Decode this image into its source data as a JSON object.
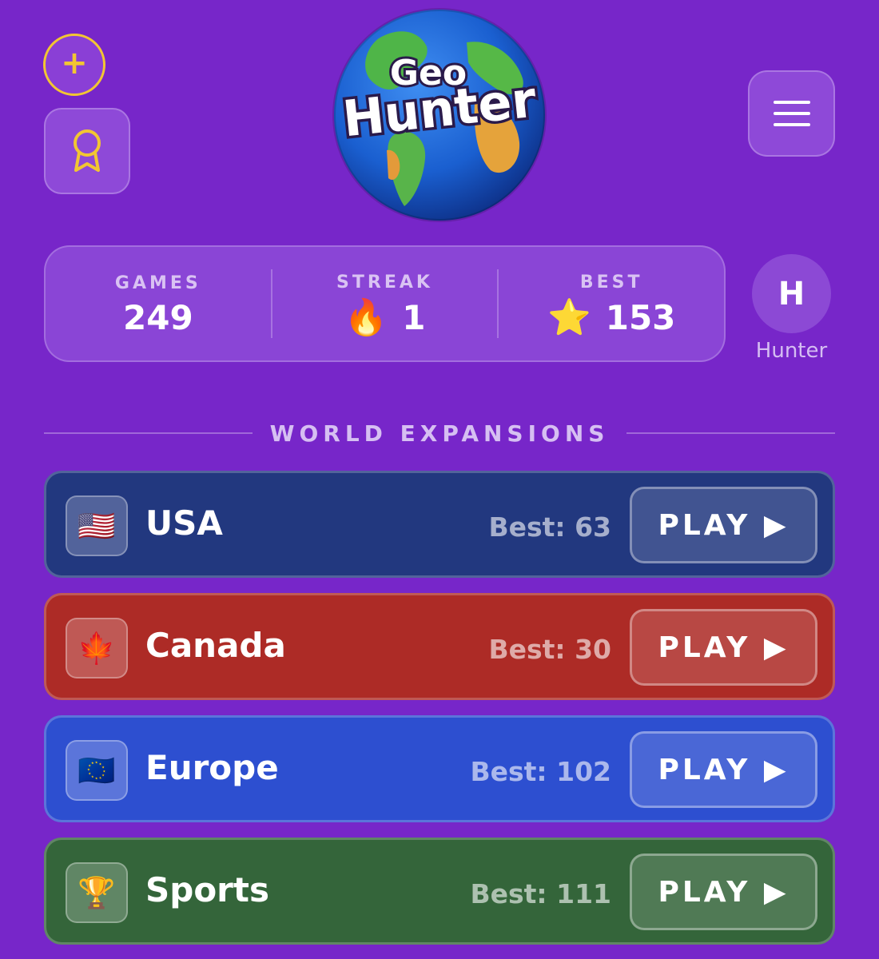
{
  "app": {
    "logo_line1": "Geo",
    "logo_line2": "Hunter"
  },
  "icons": {
    "add": "plus-icon",
    "achievements": "ribbon-award-icon",
    "menu": "hamburger-menu-icon"
  },
  "stats": {
    "games": {
      "label": "GAMES",
      "value": "249"
    },
    "streak": {
      "label": "STREAK",
      "icon": "🔥",
      "value": "1"
    },
    "best": {
      "label": "BEST",
      "icon": "⭐",
      "value": "153"
    }
  },
  "profile": {
    "initial": "H",
    "name": "Hunter"
  },
  "section": {
    "title": "WORLD EXPANSIONS"
  },
  "expansions": [
    {
      "name": "USA",
      "flag": "🇺🇸",
      "best": "Best: 63",
      "play": "PLAY ▶",
      "color": "#22387f"
    },
    {
      "name": "Canada",
      "flag": "🍁",
      "best": "Best: 30",
      "play": "PLAY ▶",
      "color": "#ad2b26"
    },
    {
      "name": "Europe",
      "flag": "🇪🇺",
      "best": "Best: 102",
      "play": "PLAY ▶",
      "color": "#2d4fd0"
    },
    {
      "name": "Sports",
      "flag": "🏆",
      "best": "Best: 111",
      "play": "PLAY ▶",
      "color": "#34653a"
    }
  ],
  "colors": {
    "background": "#7726c9",
    "accent_gold": "#f2c632"
  }
}
